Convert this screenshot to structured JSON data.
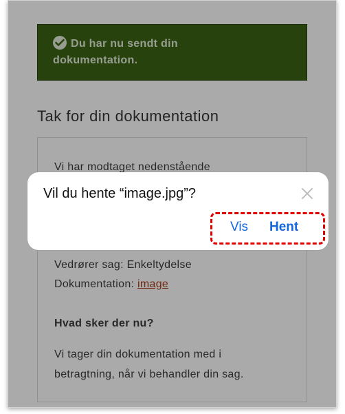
{
  "banner": {
    "icon": "check-circle-icon",
    "text_line1": "Du har nu sendt din",
    "text_line2": "dokumentation."
  },
  "page": {
    "title": "Tak for din dokumentation"
  },
  "card": {
    "line_received": "Vi har modtaget nedenstående",
    "case_label": "Vedrører sag: Enkeltydelse",
    "doc_label": "Dokumentation: ",
    "doc_link": "image",
    "next_heading": "Hvad sker der nu?",
    "next_line1": "Vi tager din dokumentation med i",
    "next_line2": "betragtning, når vi behandler din sag."
  },
  "dialog": {
    "question": "Vil du hente “image.jpg”?",
    "close_icon": "close-icon",
    "view_label": "Vis",
    "download_label": "Hent"
  },
  "colors": {
    "banner_bg": "#385f12",
    "link": "#a33a1c",
    "dialog_button": "#1466dc",
    "highlight": "#e00000"
  }
}
